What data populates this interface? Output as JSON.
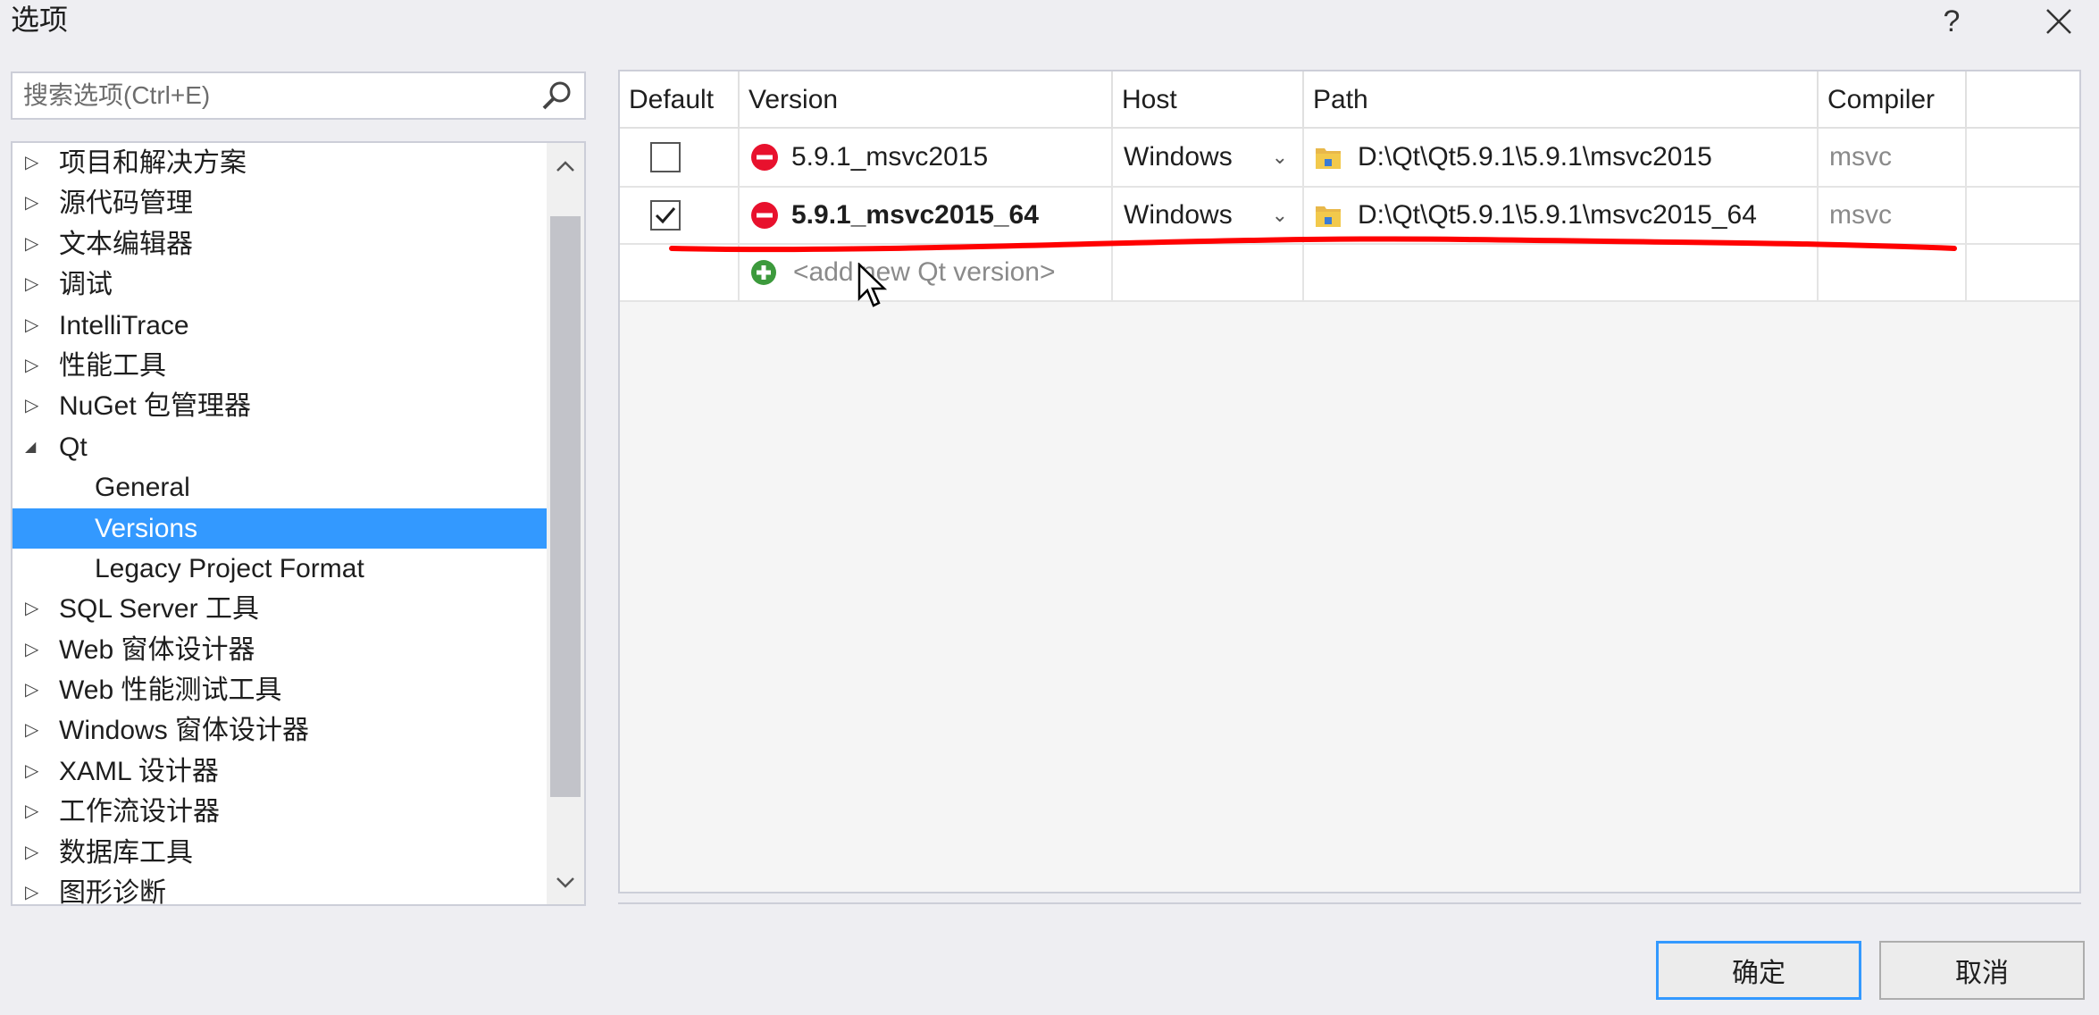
{
  "window": {
    "title": "选项",
    "help_label": "?",
    "close_label": "✕"
  },
  "search": {
    "placeholder": "搜索选项(Ctrl+E)"
  },
  "tree": {
    "items": [
      {
        "label": "项目和解决方案",
        "arrow": "▷"
      },
      {
        "label": "源代码管理",
        "arrow": "▷"
      },
      {
        "label": "文本编辑器",
        "arrow": "▷"
      },
      {
        "label": "调试",
        "arrow": "▷"
      },
      {
        "label": "IntelliTrace",
        "arrow": "▷"
      },
      {
        "label": "性能工具",
        "arrow": "▷"
      },
      {
        "label": "NuGet 包管理器",
        "arrow": "▷"
      },
      {
        "label": "Qt",
        "arrow": "◢"
      },
      {
        "label": "General"
      },
      {
        "label": "Versions"
      },
      {
        "label": "Legacy Project Format"
      },
      {
        "label": "SQL Server 工具",
        "arrow": "▷"
      },
      {
        "label": "Web 窗体设计器",
        "arrow": "▷"
      },
      {
        "label": "Web 性能测试工具",
        "arrow": "▷"
      },
      {
        "label": "Windows 窗体设计器",
        "arrow": "▷"
      },
      {
        "label": "XAML 设计器",
        "arrow": "▷"
      },
      {
        "label": "工作流设计器",
        "arrow": "▷"
      },
      {
        "label": "数据库工具",
        "arrow": "▷"
      },
      {
        "label": "图形诊断",
        "arrow": "▷"
      }
    ],
    "selected": "Versions"
  },
  "grid": {
    "columns": [
      "Default",
      "Version",
      "Host",
      "Path",
      "Compiler"
    ],
    "rows": [
      {
        "default": false,
        "version": "5.9.1_msvc2015",
        "host": "Windows",
        "path": "D:\\Qt\\Qt5.9.1\\5.9.1\\msvc2015",
        "compiler": "msvc"
      },
      {
        "default": true,
        "version": "5.9.1_msvc2015_64",
        "host": "Windows",
        "path": "D:\\Qt\\Qt5.9.1\\5.9.1\\msvc2015_64",
        "compiler": "msvc"
      }
    ],
    "add_label": "<add new Qt version>",
    "host_arrow": "⌄"
  },
  "buttons": {
    "ok": "确定",
    "cancel": "取消"
  },
  "colors": {
    "selection": "#3399ff",
    "annotation": "#ff0000",
    "error": "#e8112d",
    "add": "#3c9a3c"
  }
}
